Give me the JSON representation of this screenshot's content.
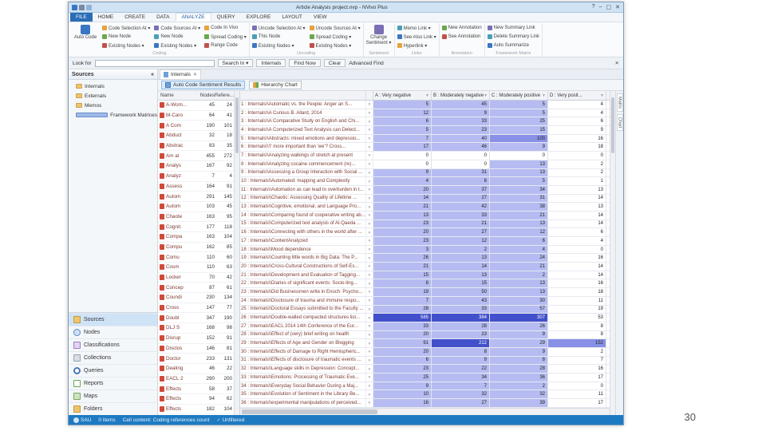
{
  "slide": {
    "page_number": "30"
  },
  "window": {
    "title": "Article Analysis project.nvp - NVivo Plus",
    "controls": {
      "help": "?",
      "minimize": "–",
      "maximize": "▢",
      "close": "✕"
    }
  },
  "ribbon": {
    "tabs": [
      "FILE",
      "HOME",
      "CREATE",
      "DATA",
      "ANALYZE",
      "QUERY",
      "EXPLORE",
      "LAYOUT",
      "VIEW"
    ],
    "active_tab": "ANALYZE",
    "groups": [
      {
        "name": "Coding",
        "cols": [
          [
            "Code Selection At ▾",
            "New Node",
            "Existing Nodes ▾"
          ],
          [
            "Code Sources At ▾",
            "New Node",
            "Existing Nodes ▾"
          ],
          [
            "Code In Vivo",
            "Spread Coding ▾",
            "Range Code"
          ]
        ],
        "big": [
          "Auto Code"
        ]
      },
      {
        "name": "Uncoding",
        "cols": [
          [
            "Uncode Selection At ▾",
            "This Node",
            "Existing Nodes ▾"
          ],
          [
            "Uncode Sources At ▾",
            "Spread Coding ▾",
            "Existing Nodes ▾"
          ]
        ]
      },
      {
        "name": "Sentiment",
        "big": [
          "Change Sentiment ▾"
        ]
      },
      {
        "name": "Links",
        "cols": [
          [
            "Memo Link ▾",
            "See Also Link ▾",
            "Hyperlink ▾"
          ]
        ]
      },
      {
        "name": "Annotation",
        "cols": [
          [
            "New Annotation",
            "See Annotation"
          ]
        ]
      },
      {
        "name": "Framework Matrix",
        "cols": [
          [
            "New Summary Link",
            "Delete Summary Link",
            "Auto Summarize"
          ]
        ]
      }
    ]
  },
  "search": {
    "look_for": "Look for",
    "value": "",
    "search_in": "Search In ▾",
    "scope": "Internals",
    "find_now": "Find Now",
    "clear": "Clear",
    "advanced": "Advanced Find",
    "close": "✕"
  },
  "nav": {
    "header": "Sources",
    "collapse_glyph": "«",
    "tree": [
      {
        "label": "Internals",
        "icon": "folder-icon"
      },
      {
        "label": "Externals",
        "icon": "folder-icon"
      },
      {
        "label": "Memos",
        "icon": "folder-icon"
      },
      {
        "label": "Framework Matrices",
        "icon": "framework-matrix-icon"
      }
    ],
    "bottom": [
      {
        "label": "Sources",
        "icon": "sources"
      },
      {
        "label": "Nodes",
        "icon": "nodes"
      },
      {
        "label": "Classifications",
        "icon": "classifications"
      },
      {
        "label": "Collections",
        "icon": "collections"
      },
      {
        "label": "Queries",
        "icon": "queries"
      },
      {
        "label": "Reports",
        "icon": "reports"
      },
      {
        "label": "Maps",
        "icon": "maps"
      },
      {
        "label": "Folders",
        "icon": "folders"
      }
    ],
    "active": "Sources"
  },
  "detail": {
    "doc_tab": "Internals",
    "doc_tab_close": "✕",
    "view_tabs": [
      {
        "label": "Auto Code Sentiment Results",
        "selected": true
      },
      {
        "label": "Hierarchy Chart",
        "selected": false
      }
    ],
    "side_tabs": [
      "Matrix",
      "Chart"
    ]
  },
  "sources": {
    "columns": {
      "name": "Name",
      "nodes": "Nodes",
      "references": "Refere..."
    },
    "rows": [
      {
        "name": "A-Wom...",
        "nodes": 45,
        "references": 24
      },
      {
        "name": "M-Caro",
        "nodes": 64,
        "references": 41
      },
      {
        "name": "A Com",
        "nodes": 190,
        "references": 101
      },
      {
        "name": "Abduct",
        "nodes": 32,
        "references": 18
      },
      {
        "name": "Abstrac",
        "nodes": 83,
        "references": 35
      },
      {
        "name": "Am al",
        "nodes": 455,
        "references": 272
      },
      {
        "name": "Analys",
        "nodes": 167,
        "references": 92
      },
      {
        "name": "Analyz",
        "nodes": 7,
        "references": 4
      },
      {
        "name": "Assess",
        "nodes": 164,
        "references": 91
      },
      {
        "name": "Autom",
        "nodes": 291,
        "references": 145
      },
      {
        "name": "Autom",
        "nodes": 103,
        "references": 45
      },
      {
        "name": "Chaote",
        "nodes": 163,
        "references": 95
      },
      {
        "name": "Cognit",
        "nodes": 177,
        "references": 118
      },
      {
        "name": "Compa",
        "nodes": 163,
        "references": 104
      },
      {
        "name": "Compu",
        "nodes": 162,
        "references": 85
      },
      {
        "name": "Comu",
        "nodes": 110,
        "references": 60
      },
      {
        "name": "Cosm",
        "nodes": 110,
        "references": 63
      },
      {
        "name": "Locker",
        "nodes": 70,
        "references": 42
      },
      {
        "name": "Concep",
        "nodes": 87,
        "references": 61
      },
      {
        "name": "Coundi",
        "nodes": 230,
        "references": 134
      },
      {
        "name": "Cross",
        "nodes": 147,
        "references": 77
      },
      {
        "name": "Doubl",
        "nodes": 347,
        "references": 190
      },
      {
        "name": "DLJ S",
        "nodes": 168,
        "references": 98
      },
      {
        "name": "Disrup",
        "nodes": 152,
        "references": 91
      },
      {
        "name": "Disclos",
        "nodes": 146,
        "references": 81
      },
      {
        "name": "Doctor",
        "nodes": 233,
        "references": 131
      },
      {
        "name": "Dealing",
        "nodes": 46,
        "references": 22
      },
      {
        "name": "EACL 2",
        "nodes": 290,
        "references": 200
      },
      {
        "name": "Effects",
        "nodes": 58,
        "references": 37
      },
      {
        "name": "Effects",
        "nodes": 94,
        "references": 62
      },
      {
        "name": "Effects",
        "nodes": 182,
        "references": 104
      }
    ]
  },
  "matrix": {
    "columns": [
      "A : Very negative",
      "B : Moderately negative",
      "C : Moderately positive",
      "D : Very posit..."
    ],
    "filter_glyph": "▼",
    "rows": [
      {
        "label": "1 : Internals\\\\Automatic vs. the People: Anger an S...",
        "values": [
          5,
          45,
          5,
          4
        ]
      },
      {
        "label": "2 : Internals\\\\A Curious B. Allard, 2014",
        "values": [
          12,
          9,
          5,
          4
        ]
      },
      {
        "label": "3 : Internals\\\\A Comparative Study on English and Chi...",
        "values": [
          6,
          33,
          25,
          6
        ]
      },
      {
        "label": "4 : Internals\\\\A Computerized Text Analysis can Detect...",
        "values": [
          5,
          23,
          15,
          9
        ]
      },
      {
        "label": "5 : Internals\\\\Abstracts: mixed emotions and depressio...",
        "values": [
          7,
          40,
          100,
          16
        ]
      },
      {
        "label": "6 : Internals\\\\'I' more important than 'we'? Cross...",
        "values": [
          17,
          46,
          9,
          18
        ]
      },
      {
        "label": "7 : Internals\\\\Analyzing walkings of stretch at present",
        "values": [
          0,
          0,
          0,
          0
        ]
      },
      {
        "label": "8 : Internals\\\\Analyzing cocaine commencement (re)...",
        "values": [
          0,
          0,
          13,
          2
        ]
      },
      {
        "label": "9 : Internals\\\\Assessing a Group Interaction with Social ...",
        "values": [
          9,
          31,
          13,
          2
        ]
      },
      {
        "label": "10 : Internals\\\\Automated: mapping and Complexity",
        "values": [
          4,
          6,
          5,
          1
        ]
      },
      {
        "label": "11 : Internals\\\\Automation as can lead to overburden in t...",
        "values": [
          20,
          37,
          34,
          13
        ]
      },
      {
        "label": "12 : Internals\\\\Chaotic: Assessing Quality of Lifetime ...",
        "values": [
          14,
          27,
          31,
          14
        ]
      },
      {
        "label": "13 : Internals\\\\Cognitive, emotional, and Language Pro...",
        "values": [
          21,
          42,
          38,
          13
        ]
      },
      {
        "label": "14 : Internals\\\\Comparing found of cooperative writing ab...",
        "values": [
          13,
          33,
          21,
          14
        ]
      },
      {
        "label": "15 : Internals\\\\Computerized text analysis of Al-Qaeda ...",
        "values": [
          23,
          21,
          13,
          14
        ]
      },
      {
        "label": "16 : Internals\\\\Connecting with others in the world after ...",
        "values": [
          20,
          27,
          12,
          6
        ]
      },
      {
        "label": "17 : Internals\\\\ContentAnalyzed",
        "values": [
          23,
          12,
          6,
          4
        ]
      },
      {
        "label": "18 : Internals\\\\Mood dependence",
        "values": [
          3,
          2,
          4,
          0
        ]
      },
      {
        "label": "19 : Internals\\\\Counting little words in Big Data: The P...",
        "values": [
          26,
          13,
          24,
          16
        ]
      },
      {
        "label": "20 : Internals\\\\Cross-Cultural Constructions of Self-Es...",
        "values": [
          21,
          14,
          21,
          14
        ]
      },
      {
        "label": "21 : Internals\\\\Development and Evaluation of Tagging...",
        "values": [
          15,
          13,
          2,
          14
        ]
      },
      {
        "label": "22 : Internals\\\\Diaries of significant events: Socio-ling...",
        "values": [
          8,
          15,
          13,
          16
        ]
      },
      {
        "label": "23 : Internals\\\\Did Businessmen write in Enoch: Psycho...",
        "values": [
          19,
          50,
          13,
          18
        ]
      },
      {
        "label": "24 : Internals\\\\Disclosure of trauma and immune respo...",
        "values": [
          7,
          43,
          30,
          11
        ]
      },
      {
        "label": "25 : Internals\\\\Doctoral Essays submitted to the Faculty ...",
        "values": [
          28,
          33,
          57,
          19
        ]
      },
      {
        "label": "26 : Internals\\\\Double-walled compacted structures list...",
        "values": [
          585,
          384,
          307,
          53
        ]
      },
      {
        "label": "27 : Internals\\\\EACL 2014 14th Conference of the Eur...",
        "values": [
          33,
          28,
          26,
          8
        ]
      },
      {
        "label": "28 : Internals\\\\Effect of (very) brief writing on health",
        "values": [
          20,
          23,
          9,
          8
        ]
      },
      {
        "label": "29 : Internals\\\\Effects of Age and Gender on Blogging",
        "values": [
          91,
          212,
          29,
          152
        ]
      },
      {
        "label": "30 : Internals\\\\Effects of Damage to Right Hemispheric...",
        "values": [
          20,
          8,
          9,
          2
        ]
      },
      {
        "label": "31 : Internals\\\\Effects of disclosure of traumatic events ...",
        "values": [
          6,
          9,
          8,
          7
        ]
      },
      {
        "label": "32 : Internals\\\\Language skills in Depression: Concept...",
        "values": [
          23,
          22,
          28,
          16
        ]
      },
      {
        "label": "33 : Internals\\\\Emotions: Processing of Traumatic Eve...",
        "values": [
          25,
          34,
          36,
          17
        ]
      },
      {
        "label": "34 : Internals\\\\Everyday Social Behavior During a Maj...",
        "values": [
          9,
          7,
          2,
          0
        ]
      },
      {
        "label": "35 : Internals\\\\Evolution of Sentiment in the Library Be...",
        "values": [
          10,
          32,
          32,
          11
        ]
      },
      {
        "label": "36 : Internals\\\\experimental manipulations of perceived...",
        "values": [
          16,
          27,
          39,
          17
        ]
      }
    ]
  },
  "statusbar": {
    "items": [
      {
        "label": "SAU",
        "icon": "user"
      },
      {
        "label": "0 Items"
      },
      {
        "label": "Cell content: Coding references count"
      },
      {
        "label": "Unfiltered",
        "icon": "check"
      }
    ]
  },
  "colors": {
    "cell_light": "#b6bcf1",
    "cell_mid": "#8891e6",
    "cell_dark": "#4250cb",
    "statusbar": "#1d7ac2",
    "file_tab": "#2a6cb5"
  }
}
